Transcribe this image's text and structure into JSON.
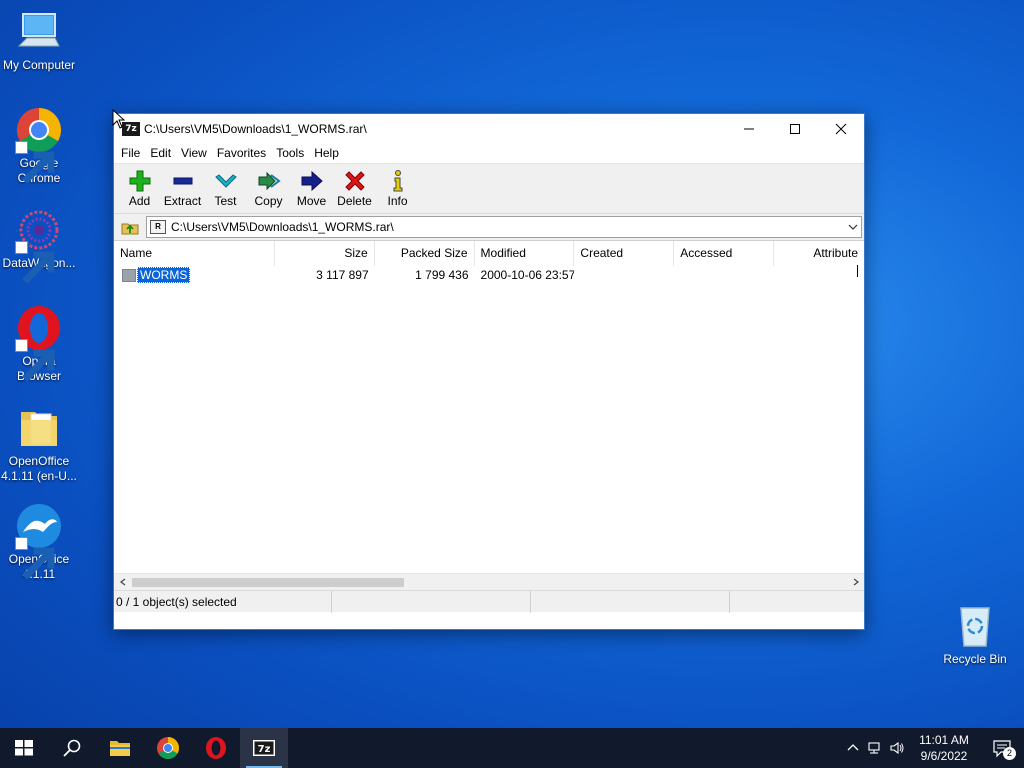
{
  "desktop": {
    "icons": [
      {
        "label": "My Computer"
      },
      {
        "label": "Google Chrome"
      },
      {
        "label": "DataWagon..."
      },
      {
        "label": "Opera Browser"
      },
      {
        "label": "OpenOffice 4.1.11 (en-U..."
      },
      {
        "label": "OpenOffice 4.1.11"
      },
      {
        "label": "Recycle Bin"
      }
    ]
  },
  "window": {
    "app_badge": "7z",
    "title": "C:\\Users\\VM5\\Downloads\\1_WORMS.rar\\",
    "menu": [
      "File",
      "Edit",
      "View",
      "Favorites",
      "Tools",
      "Help"
    ],
    "toolbar": [
      {
        "label": "Add",
        "icon": "plus-icon",
        "color": "#1db21d"
      },
      {
        "label": "Extract",
        "icon": "minus-icon",
        "color": "#1a2a9a"
      },
      {
        "label": "Test",
        "icon": "check-chevron-icon",
        "color": "#1ab0c8"
      },
      {
        "label": "Copy",
        "icon": "double-arrow-right-icon",
        "color": "#2a8a4a"
      },
      {
        "label": "Move",
        "icon": "arrow-right-icon",
        "color": "#16208a"
      },
      {
        "label": "Delete",
        "icon": "x-icon",
        "color": "#d81818"
      },
      {
        "label": "Info",
        "icon": "info-icon",
        "color": "#e8d000"
      }
    ],
    "address": {
      "icon_text": "R",
      "path": "C:\\Users\\VM5\\Downloads\\1_WORMS.rar\\"
    },
    "columns": {
      "name": "Name",
      "size": "Size",
      "packed": "Packed Size",
      "modified": "Modified",
      "created": "Created",
      "accessed": "Accessed",
      "attributes": "Attribute"
    },
    "rows": [
      {
        "name": "WORMS",
        "size": "3 117 897",
        "packed": "1 799 436",
        "modified": "2000-10-06 23:57",
        "created": "",
        "accessed": ""
      }
    ],
    "status": {
      "selection": "0 / 1 object(s) selected",
      "cell2": "",
      "cell3": ""
    }
  },
  "taskbar": {
    "time": "11:01 AM",
    "date": "9/6/2022",
    "notification_count": "2"
  }
}
